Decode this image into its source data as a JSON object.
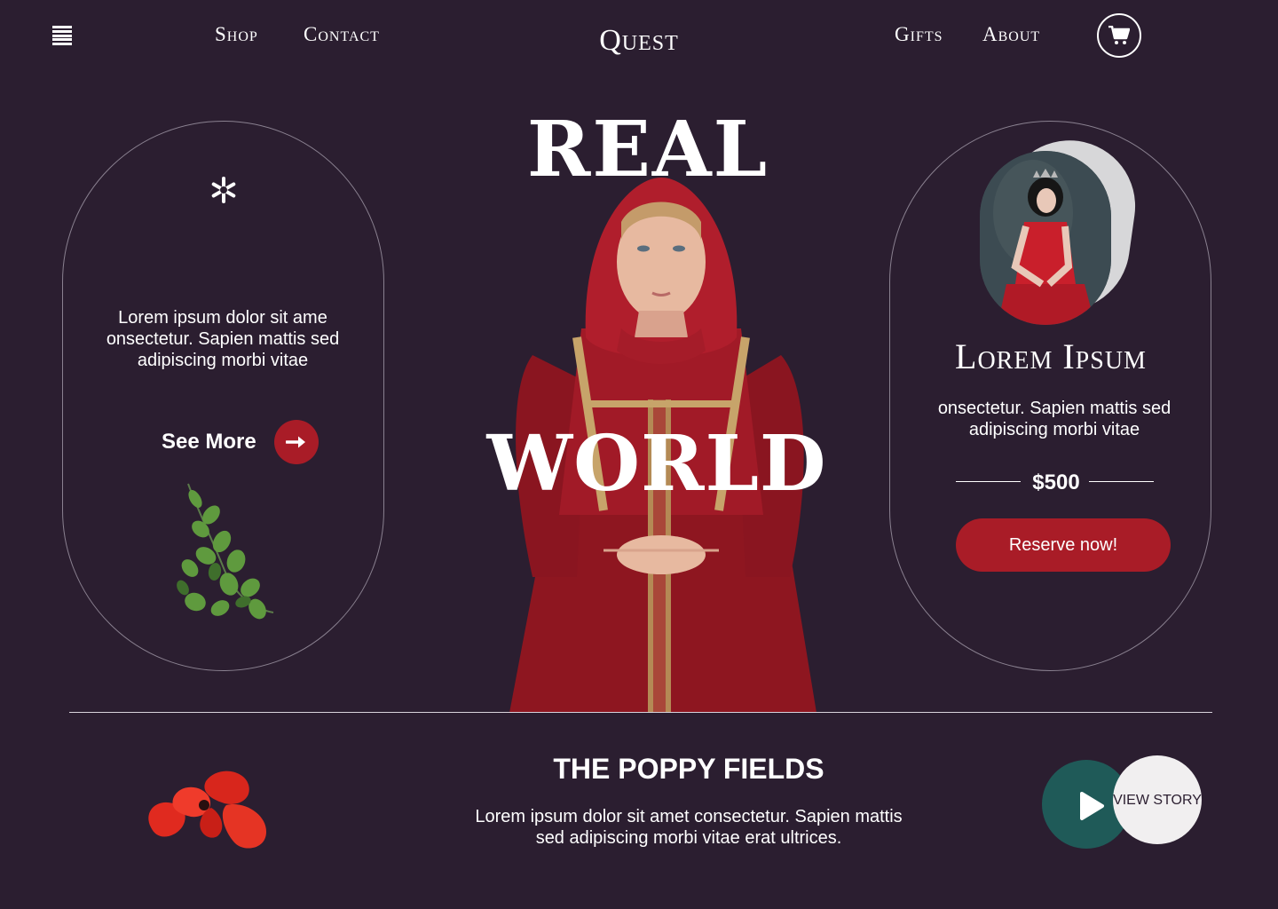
{
  "nav": {
    "shop": "Shop",
    "contact": "Contact",
    "logo": "Quest",
    "gifts": "Gifts",
    "about": "About",
    "menu_icon": "hamburger-menu-icon",
    "cart_icon": "cart-icon"
  },
  "hero": {
    "line1": "REAL",
    "line2": "WORLD"
  },
  "left_card": {
    "icon": "snowflake-icon",
    "text": "Lorem ipsum dolor sit ame onsectetur. Sapien mattis sed adipiscing morbi vitae",
    "cta": "See More",
    "cta_icon": "arrow-right-icon"
  },
  "right_card": {
    "title": "Lorem Ipsum",
    "text": "onsectetur. Sapien mattis sed adipiscing morbi vitae",
    "price": "$500",
    "button": "Reserve now!"
  },
  "bottom": {
    "title": "THE POPPY FIELDS",
    "text": "Lorem ipsum dolor sit amet consectetur. Sapien mattis sed adipiscing morbi vitae erat ultrices.",
    "play_icon": "play-icon",
    "view_story": "VIEW STORY"
  },
  "colors": {
    "background": "#2b1e30",
    "accent_red": "#a91c27",
    "teal": "#1f5a58"
  }
}
